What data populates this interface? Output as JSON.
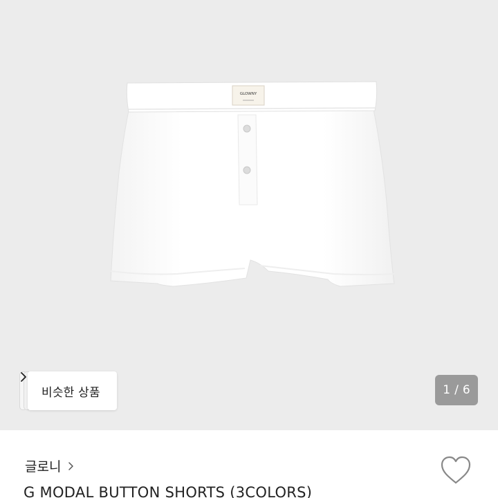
{
  "gallery": {
    "product_tag": "GLOWNY",
    "similar_label": "비슷한 상품",
    "current_page": "1",
    "page_separator": "/",
    "total_pages": "6"
  },
  "product": {
    "brand": "글로니",
    "title": "G MODAL BUTTON SHORTS (3COLORS)"
  },
  "colors": {
    "image_bg": "#ececec",
    "indicator_bg": "#9a9a9a",
    "text": "#222222"
  },
  "icons": {
    "similar_chevron": "chevron-right-icon",
    "brand_chevron": "chevron-right-icon",
    "wishlist": "heart-outline-icon"
  }
}
